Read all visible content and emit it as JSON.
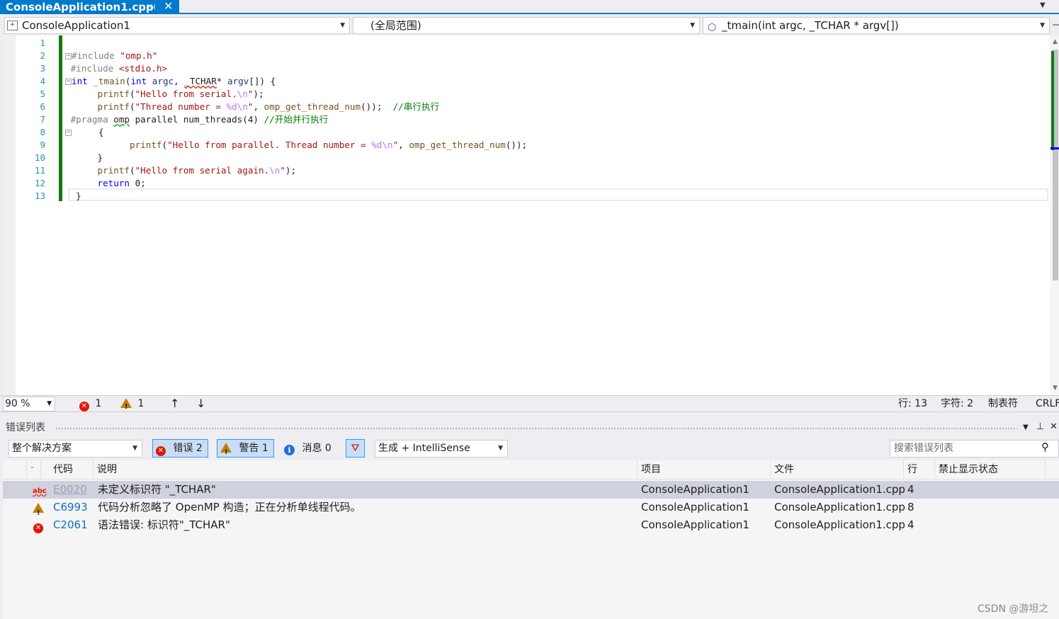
{
  "tab": {
    "title": "ConsoleApplication1.cpp",
    "pin": "⊣",
    "close": "✕"
  },
  "nav": {
    "project": "ConsoleApplication1",
    "scope": "(全局范围)",
    "member": "_tmain(int argc, _TCHAR * argv[])"
  },
  "editor": {
    "line_numbers": [
      "1",
      "2",
      "3",
      "4",
      "5",
      "6",
      "7",
      "8",
      "9",
      "10",
      "11",
      "12",
      "13"
    ]
  },
  "status": {
    "zoom": "90 %",
    "errors": "1",
    "warnings": "1",
    "line": "行: 13",
    "char": "字符: 2",
    "tabs": "制表符",
    "eol": "CRLF"
  },
  "error_list": {
    "title": "错误列表",
    "scope": "整个解决方案",
    "errors_btn": "错误 2",
    "warnings_btn": "警告 1",
    "messages_btn": "消息 0",
    "build_filter": "生成 + IntelliSense",
    "search_placeholder": "搜索错误列表",
    "columns": [
      "代码",
      "说明",
      "项目",
      "文件",
      "行",
      "禁止显示状态"
    ],
    "rows": [
      {
        "icon": "abc-squiggle-icon",
        "code": "E0020",
        "description": "未定义标识符 \"_TCHAR\"",
        "project": "ConsoleApplication1",
        "file": "ConsoleApplication1.cpp",
        "line": "4"
      },
      {
        "icon": "warning-icon",
        "code": "C6993",
        "description": "代码分析忽略了 OpenMP 构造；正在分析单线程代码。",
        "project": "ConsoleApplication1",
        "file": "ConsoleApplication1.cpp",
        "line": "8"
      },
      {
        "icon": "error-icon",
        "code": "C2061",
        "description": "语法错误: 标识符\"_TCHAR\"",
        "project": "ConsoleApplication1",
        "file": "ConsoleApplication1.cpp",
        "line": "4"
      }
    ]
  },
  "watermark": "CSDN @游坦之",
  "colors": {
    "accent": "#007acc",
    "error": "#e51400",
    "warning": "#c08000",
    "info": "#1e6fd9",
    "change_bar": "#107c10"
  }
}
